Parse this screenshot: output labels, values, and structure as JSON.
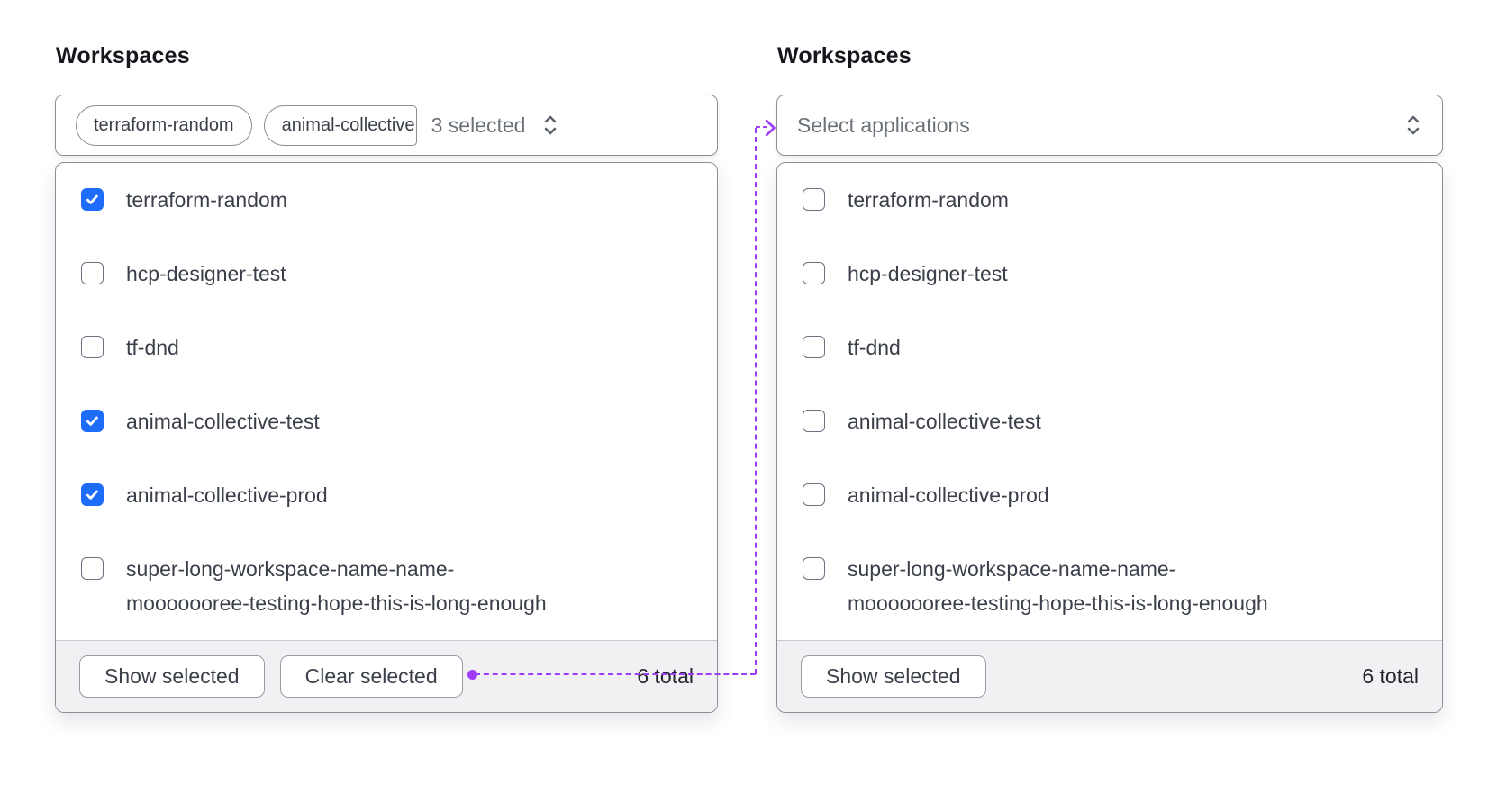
{
  "colors": {
    "checkbox_checked": "#1e6dfa",
    "annotation_purple": "#9e3cf6",
    "border_gray": "#8a8f99",
    "footer_bg": "#f1f1f3",
    "muted_text": "#6b7178",
    "text": "#3a3f4a"
  },
  "annotation": {
    "type": "dotted-connector",
    "from": "left-clear-selected-button",
    "to": "right-select-trigger",
    "color": "#9e3cf6"
  },
  "panels": [
    {
      "label": "Workspaces",
      "trigger": {
        "tags": [
          "terraform-random",
          "animal-collective"
        ],
        "summary": "3 selected",
        "caret_icon": "caret-updown-icon"
      },
      "items": [
        {
          "label": "terraform-random",
          "checked": true
        },
        {
          "label": "hcp-designer-test",
          "checked": false
        },
        {
          "label": "tf-dnd",
          "checked": false
        },
        {
          "label": "animal-collective-test",
          "checked": true
        },
        {
          "label": "animal-collective-prod",
          "checked": true
        },
        {
          "label": "super-long-workspace-name-name-mooooooree-testing-hope-this-is-long-enough",
          "checked": false
        }
      ],
      "footer": {
        "show_selected_label": "Show selected",
        "clear_selected_label": "Clear selected",
        "total": "6 total"
      }
    },
    {
      "label": "Workspaces",
      "trigger": {
        "placeholder": "Select applications",
        "caret_icon": "caret-updown-icon"
      },
      "items": [
        {
          "label": "terraform-random",
          "checked": false
        },
        {
          "label": "hcp-designer-test",
          "checked": false
        },
        {
          "label": "tf-dnd",
          "checked": false
        },
        {
          "label": "animal-collective-test",
          "checked": false
        },
        {
          "label": "animal-collective-prod",
          "checked": false
        },
        {
          "label": "super-long-workspace-name-name-mooooooree-testing-hope-this-is-long-enough",
          "checked": false
        }
      ],
      "footer": {
        "show_selected_label": "Show selected",
        "total": "6 total"
      }
    }
  ]
}
